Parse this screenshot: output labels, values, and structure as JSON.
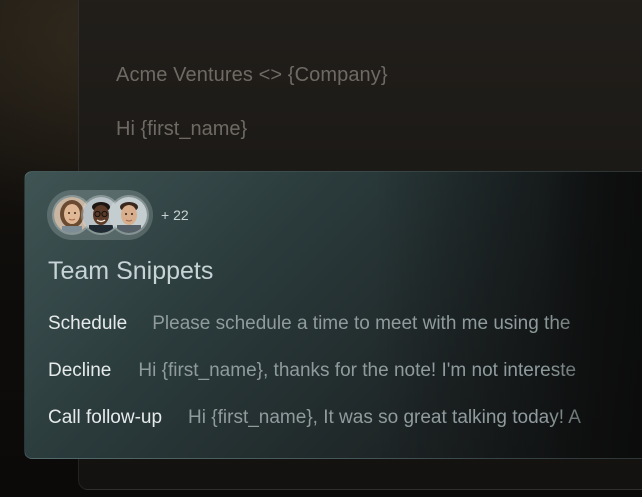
{
  "composer": {
    "subject": "Acme Ventures <> {Company}",
    "greeting": "Hi {first_name}"
  },
  "team": {
    "avatars": [
      "avatar-woman",
      "avatar-man-glasses",
      "avatar-man"
    ],
    "extra_count": "+ 22"
  },
  "snippets": {
    "title": "Team Snippets",
    "items": [
      {
        "name": "Schedule",
        "text": "Please schedule a time to meet with me using the"
      },
      {
        "name": "Decline",
        "text": "Hi {first_name}, thanks for the note! I'm not intereste"
      },
      {
        "name": "Call follow-up",
        "text": "Hi {first_name}, It was so great talking today! A"
      }
    ]
  },
  "colors": {
    "card_accent": "#3f5454",
    "background": "#0c0a08"
  }
}
